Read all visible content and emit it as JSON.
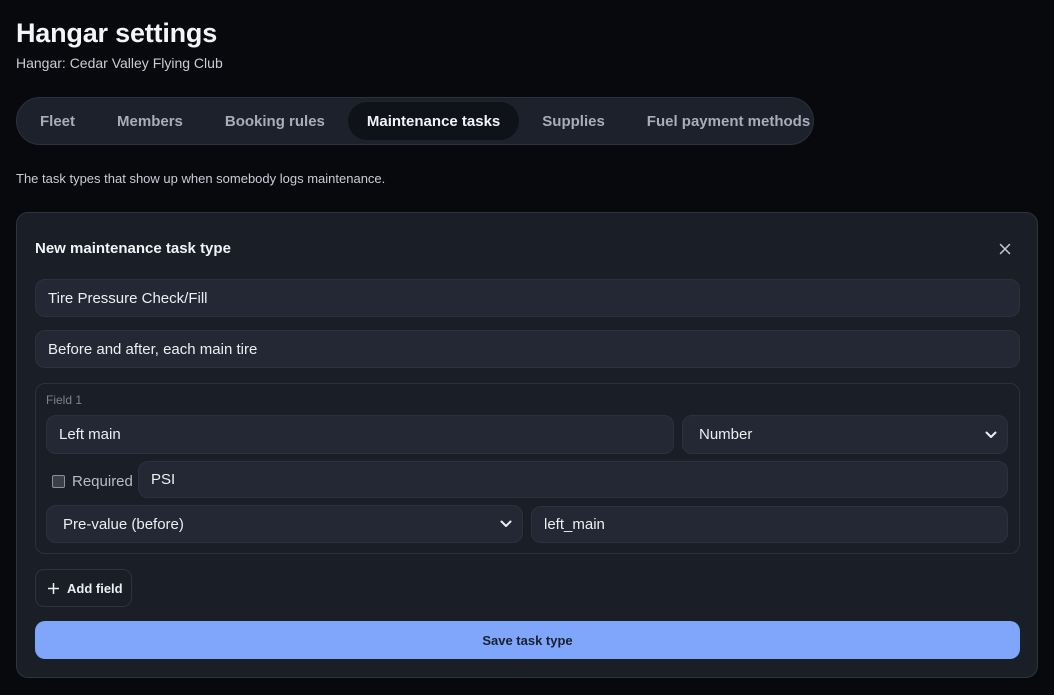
{
  "page": {
    "title": "Hangar settings",
    "subtitle": "Hangar: Cedar Valley Flying Club",
    "description": "The task types that show up when somebody logs maintenance."
  },
  "tabs": [
    {
      "label": "Fleet",
      "active": false
    },
    {
      "label": "Members",
      "active": false
    },
    {
      "label": "Booking rules",
      "active": false
    },
    {
      "label": "Maintenance tasks",
      "active": true
    },
    {
      "label": "Supplies",
      "active": false
    },
    {
      "label": "Fuel payment methods",
      "active": false
    }
  ],
  "form": {
    "title": "New maintenance task type",
    "close_icon": "close-icon",
    "name_value": "Tire Pressure Check/Fill",
    "description_value": "Before and after, each main tire",
    "fields": [
      {
        "group_label": "Field 1",
        "label_value": "Left main",
        "type_value": "Number",
        "required": false,
        "required_label": "Required",
        "unit_value": "PSI",
        "timing_value": "Pre-value (before)",
        "key_value": "left_main"
      }
    ],
    "add_field_label": "Add field",
    "save_label": "Save task type"
  },
  "colors": {
    "background": "#08090d",
    "card": "#1a1e27",
    "input": "#232834",
    "accent": "#7fa6fb"
  }
}
